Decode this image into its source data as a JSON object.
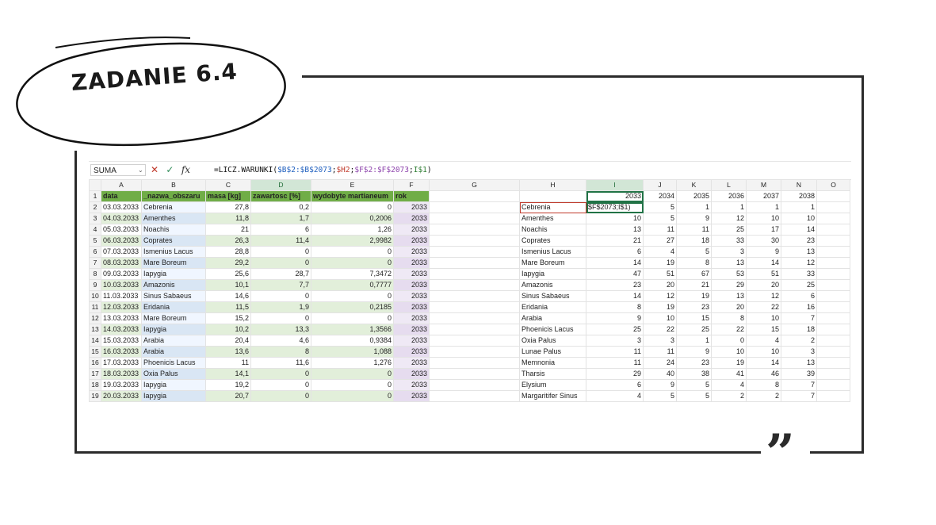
{
  "title": "ZADANIE 6.4",
  "formula_bar": {
    "name_box": "SUMA",
    "formula_parts": [
      "=LICZ.WARUNKI(",
      "$B$2:$B$2073",
      ";",
      "$H2",
      ";",
      "$F$2:$F$2073",
      ";",
      "I$1",
      ")"
    ]
  },
  "columns": [
    "A",
    "B",
    "C",
    "D",
    "E",
    "F",
    "G",
    "H",
    "I",
    "J",
    "K",
    "L",
    "M",
    "N",
    "O"
  ],
  "headers": [
    "data",
    "_nazwa_obszaru",
    "masa [kg]",
    "zawartosc [%]",
    "wydobyte martianeum",
    "rok"
  ],
  "rows": [
    [
      "03.03.2033",
      "Cebrenia",
      "27,8",
      "0,2",
      "0",
      "2033"
    ],
    [
      "04.03.2033",
      "Amenthes",
      "11,8",
      "1,7",
      "0,2006",
      "2033"
    ],
    [
      "05.03.2033",
      "Noachis",
      "21",
      "6",
      "1,26",
      "2033"
    ],
    [
      "06.03.2033",
      "Coprates",
      "26,3",
      "11,4",
      "2,9982",
      "2033"
    ],
    [
      "07.03.2033",
      "Ismenius Lacus",
      "28,8",
      "0",
      "0",
      "2033"
    ],
    [
      "08.03.2033",
      "Mare Boreum",
      "29,2",
      "0",
      "0",
      "2033"
    ],
    [
      "09.03.2033",
      "Iapygia",
      "25,6",
      "28,7",
      "7,3472",
      "2033"
    ],
    [
      "10.03.2033",
      "Amazonis",
      "10,1",
      "7,7",
      "0,7777",
      "2033"
    ],
    [
      "11.03.2033",
      "Sinus Sabaeus",
      "14,6",
      "0",
      "0",
      "2033"
    ],
    [
      "12.03.2033",
      "Eridania",
      "11,5",
      "1,9",
      "0,2185",
      "2033"
    ],
    [
      "13.03.2033",
      "Mare Boreum",
      "15,2",
      "0",
      "0",
      "2033"
    ],
    [
      "14.03.2033",
      "Iapygia",
      "10,2",
      "13,3",
      "1,3566",
      "2033"
    ],
    [
      "15.03.2033",
      "Arabia",
      "20,4",
      "4,6",
      "0,9384",
      "2033"
    ],
    [
      "16.03.2033",
      "Arabia",
      "13,6",
      "8",
      "1,088",
      "2033"
    ],
    [
      "17.03.2033",
      "Phoenicis Lacus",
      "11",
      "11,6",
      "1,276",
      "2033"
    ],
    [
      "18.03.2033",
      "Oxia Palus",
      "14,1",
      "0",
      "0",
      "2033"
    ],
    [
      "19.03.2033",
      "Iapygia",
      "19,2",
      "0",
      "0",
      "2033"
    ],
    [
      "20.03.2033",
      "Iapygia",
      "20,7",
      "0",
      "0",
      "2033"
    ]
  ],
  "years": [
    "2033",
    "2034",
    "2035",
    "2036",
    "2037",
    "2038"
  ],
  "summary": [
    {
      "name": "Cebrenia",
      "vals": [
        "$F$2073;I$1)",
        "5",
        "1",
        "1",
        "1",
        "1"
      ]
    },
    {
      "name": "Amenthes",
      "vals": [
        "10",
        "5",
        "9",
        "12",
        "10",
        "10"
      ]
    },
    {
      "name": "Noachis",
      "vals": [
        "13",
        "11",
        "11",
        "25",
        "17",
        "14"
      ]
    },
    {
      "name": "Coprates",
      "vals": [
        "21",
        "27",
        "18",
        "33",
        "30",
        "23"
      ]
    },
    {
      "name": "Ismenius Lacus",
      "vals": [
        "6",
        "4",
        "5",
        "3",
        "9",
        "13"
      ]
    },
    {
      "name": "Mare Boreum",
      "vals": [
        "14",
        "19",
        "8",
        "13",
        "14",
        "12"
      ]
    },
    {
      "name": "Iapygia",
      "vals": [
        "47",
        "51",
        "67",
        "53",
        "51",
        "33"
      ]
    },
    {
      "name": "Amazonis",
      "vals": [
        "23",
        "20",
        "21",
        "29",
        "20",
        "25"
      ]
    },
    {
      "name": "Sinus Sabaeus",
      "vals": [
        "14",
        "12",
        "19",
        "13",
        "12",
        "6"
      ]
    },
    {
      "name": "Eridania",
      "vals": [
        "8",
        "19",
        "23",
        "20",
        "22",
        "16"
      ]
    },
    {
      "name": "Arabia",
      "vals": [
        "9",
        "10",
        "15",
        "8",
        "10",
        "7"
      ]
    },
    {
      "name": "Phoenicis Lacus",
      "vals": [
        "25",
        "22",
        "25",
        "22",
        "15",
        "18"
      ]
    },
    {
      "name": "Oxia Palus",
      "vals": [
        "3",
        "3",
        "1",
        "0",
        "4",
        "2"
      ]
    },
    {
      "name": "Lunae Palus",
      "vals": [
        "11",
        "11",
        "9",
        "10",
        "10",
        "3"
      ]
    },
    {
      "name": "Memnonia",
      "vals": [
        "11",
        "24",
        "23",
        "19",
        "14",
        "13"
      ]
    },
    {
      "name": "Tharsis",
      "vals": [
        "29",
        "40",
        "38",
        "41",
        "46",
        "39"
      ]
    },
    {
      "name": "Elysium",
      "vals": [
        "6",
        "9",
        "5",
        "4",
        "8",
        "7"
      ]
    },
    {
      "name": "Margaritifer Sinus",
      "vals": [
        "4",
        "5",
        "5",
        "2",
        "2",
        "7"
      ]
    }
  ]
}
